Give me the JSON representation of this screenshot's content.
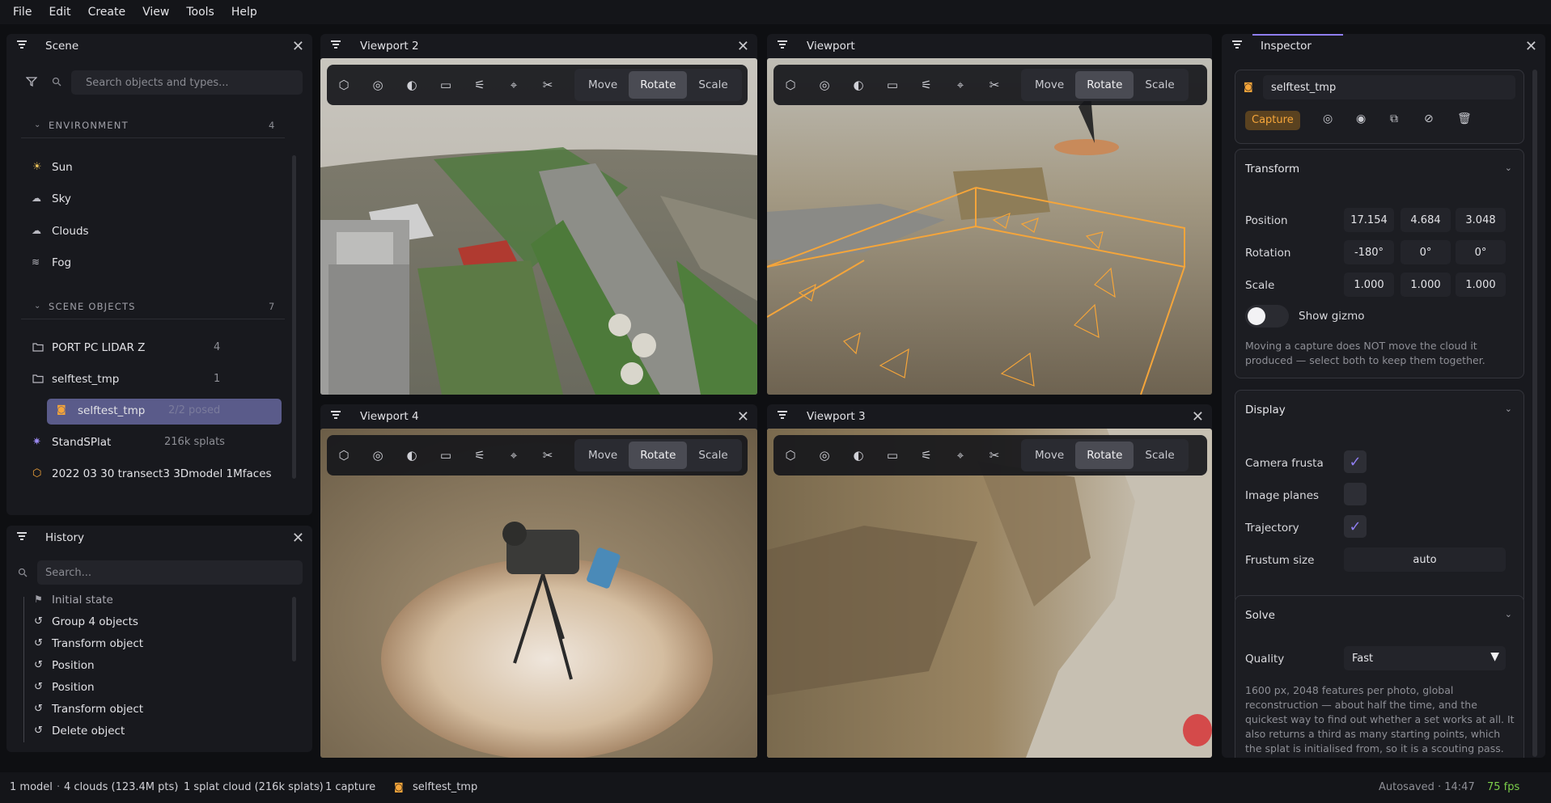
{
  "menu": [
    "File",
    "Edit",
    "Create",
    "View",
    "Tools",
    "Help"
  ],
  "scene": {
    "title": "Scene",
    "search_placeholder": "Search objects and types...",
    "environment": {
      "label": "ENVIRONMENT",
      "count": "4",
      "items": [
        "Sun",
        "Sky",
        "Clouds",
        "Fog"
      ]
    },
    "scene_objects": {
      "label": "SCENE OBJECTS",
      "count": "7",
      "items": [
        {
          "label": "PORT PC LIDAR Z",
          "meta": "4"
        },
        {
          "label": "selftest_tmp",
          "meta": "1"
        },
        {
          "label": "selftest_tmp",
          "meta": "2/2 posed"
        },
        {
          "label": "StandSPlat",
          "meta": "216k splats"
        },
        {
          "label": "2022 03 30 transect3 3Dmodel 1Mfaces",
          "meta": ""
        }
      ]
    }
  },
  "history": {
    "title": "History",
    "search_placeholder": "Search...",
    "items": [
      "Initial state",
      "Group 4 objects",
      "Transform object",
      "Position",
      "Position",
      "Transform object",
      "Delete object"
    ]
  },
  "viewports": [
    {
      "title": "Viewport 2"
    },
    {
      "title": "Viewport"
    },
    {
      "title": "Viewport 4"
    },
    {
      "title": "Viewport 3"
    }
  ],
  "tool_modes": [
    "Move",
    "Rotate",
    "Scale"
  ],
  "active_mode": "Rotate",
  "inspector": {
    "title": "Inspector",
    "object_name": "selftest_tmp",
    "badge": "Capture",
    "transform": {
      "header": "Transform",
      "position_label": "Position",
      "position": [
        "17.154",
        "4.684",
        "3.048"
      ],
      "rotation_label": "Rotation",
      "rotation": [
        "-180°",
        "0°",
        "0°"
      ],
      "scale_label": "Scale",
      "scale": [
        "1.000",
        "1.000",
        "1.000"
      ],
      "gizmo_label": "Show gizmo",
      "note": "Moving a capture does NOT move the cloud it produced — select both to keep them together."
    },
    "display": {
      "header": "Display",
      "camera_frusta": "Camera frusta",
      "image_planes": "Image planes",
      "trajectory": "Trajectory",
      "frustum_size_label": "Frustum size",
      "frustum_size": "auto",
      "camera_frusta_checked": true,
      "image_planes_checked": false,
      "trajectory_checked": true
    },
    "solve": {
      "header": "Solve",
      "quality_label": "Quality",
      "quality": "Fast",
      "note": "1600 px, 2048 features per photo, global reconstruction — about half the time, and the quickest way to find out whether a set works at all. It also returns a third as many starting points, which the splat is initialised from, so it is a scouting pass."
    }
  },
  "status": {
    "models": "1 model",
    "clouds": "4 clouds (123.4M pts)",
    "splats": "1 splat cloud (216k splats)",
    "captures": "1 capture",
    "selected": "selftest_tmp",
    "autosaved": "Autosaved · 14:47",
    "fps": "75 fps"
  },
  "colors": {
    "accent_orange": "#f5a53a",
    "accent_purple": "#8f7ef0",
    "fps_green": "#7ccf4a",
    "selection": "#5a5b8a"
  }
}
